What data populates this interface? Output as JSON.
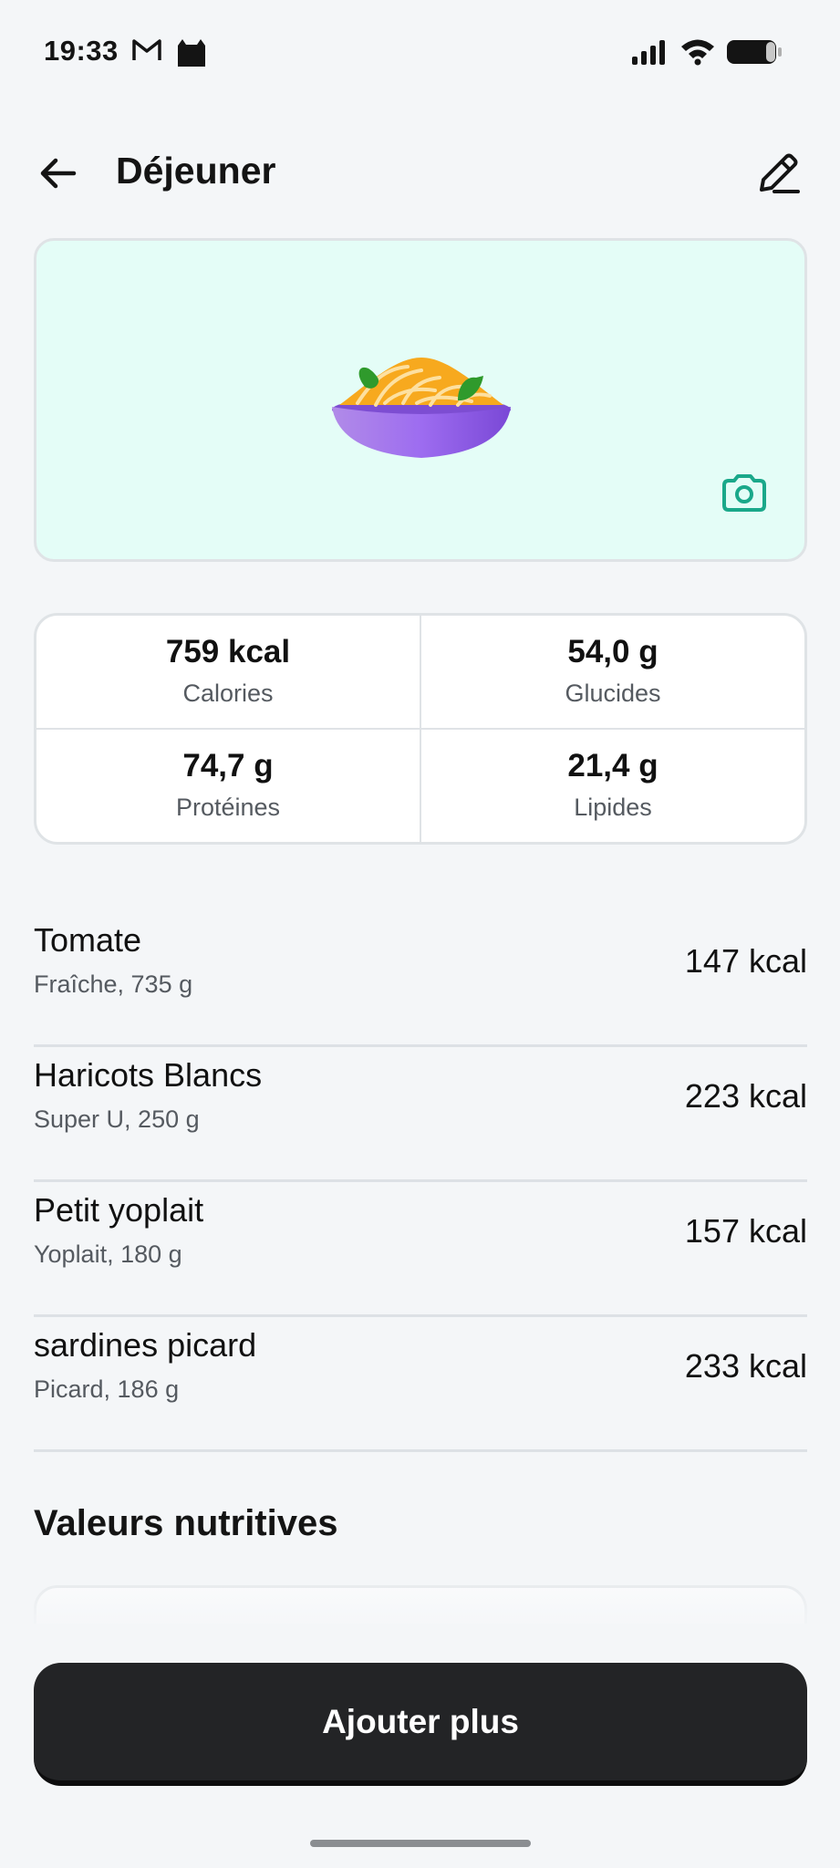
{
  "status_bar": {
    "time": "19:33"
  },
  "header": {
    "title": "Déjeuner"
  },
  "macros": [
    {
      "value": "759 kcal",
      "label": "Calories"
    },
    {
      "value": "54,0 g",
      "label": "Glucides"
    },
    {
      "value": "74,7 g",
      "label": "Protéines"
    },
    {
      "value": "21,4 g",
      "label": "Lipides"
    }
  ],
  "foods": [
    {
      "name": "Tomate",
      "detail": "Fraîche, 735 g",
      "kcal": "147 kcal"
    },
    {
      "name": "Haricots Blancs",
      "detail": "Super U, 250 g",
      "kcal": "223 kcal"
    },
    {
      "name": "Petit yoplait",
      "detail": "Yoplait, 180 g",
      "kcal": "157 kcal"
    },
    {
      "name": "sardines picard",
      "detail": "Picard, 186 g",
      "kcal": "233 kcal"
    }
  ],
  "nutrition": {
    "title": "Valeurs nutritives"
  },
  "actions": {
    "add_label": "Ajouter plus"
  },
  "colors": {
    "background": "#f4f6f8",
    "photo_bg": "#e4fdf7",
    "accent_teal": "#1aa88a",
    "button_dark": "#232426"
  },
  "icons": {
    "back": "arrow-left-icon",
    "edit": "pencil-icon",
    "camera": "camera-icon",
    "meal": "pasta-bowl-illustration"
  }
}
